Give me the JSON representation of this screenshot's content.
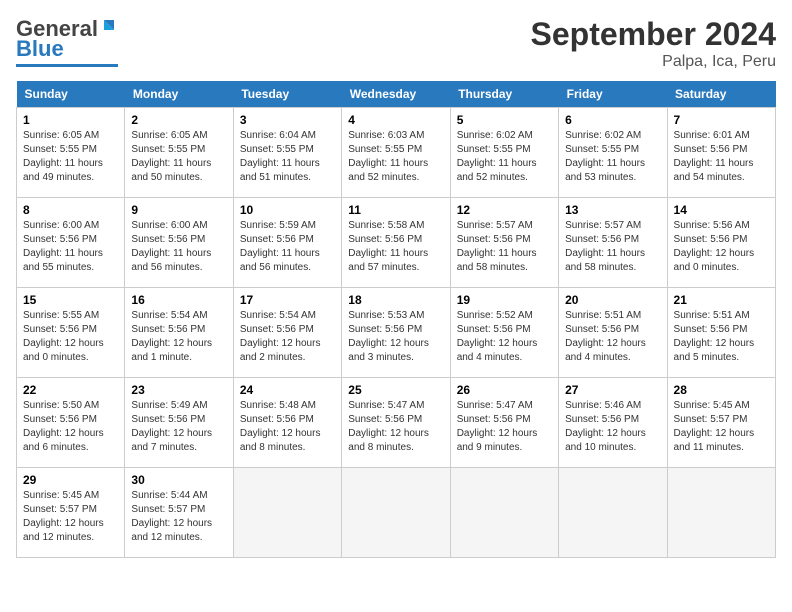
{
  "header": {
    "logo_general": "General",
    "logo_blue": "Blue",
    "month_title": "September 2024",
    "location": "Palpa, Ica, Peru"
  },
  "days_of_week": [
    "Sunday",
    "Monday",
    "Tuesday",
    "Wednesday",
    "Thursday",
    "Friday",
    "Saturday"
  ],
  "weeks": [
    [
      {
        "num": "1",
        "sunrise": "Sunrise: 6:05 AM",
        "sunset": "Sunset: 5:55 PM",
        "daylight": "Daylight: 11 hours and 49 minutes."
      },
      {
        "num": "2",
        "sunrise": "Sunrise: 6:05 AM",
        "sunset": "Sunset: 5:55 PM",
        "daylight": "Daylight: 11 hours and 50 minutes."
      },
      {
        "num": "3",
        "sunrise": "Sunrise: 6:04 AM",
        "sunset": "Sunset: 5:55 PM",
        "daylight": "Daylight: 11 hours and 51 minutes."
      },
      {
        "num": "4",
        "sunrise": "Sunrise: 6:03 AM",
        "sunset": "Sunset: 5:55 PM",
        "daylight": "Daylight: 11 hours and 52 minutes."
      },
      {
        "num": "5",
        "sunrise": "Sunrise: 6:02 AM",
        "sunset": "Sunset: 5:55 PM",
        "daylight": "Daylight: 11 hours and 52 minutes."
      },
      {
        "num": "6",
        "sunrise": "Sunrise: 6:02 AM",
        "sunset": "Sunset: 5:55 PM",
        "daylight": "Daylight: 11 hours and 53 minutes."
      },
      {
        "num": "7",
        "sunrise": "Sunrise: 6:01 AM",
        "sunset": "Sunset: 5:56 PM",
        "daylight": "Daylight: 11 hours and 54 minutes."
      }
    ],
    [
      {
        "num": "8",
        "sunrise": "Sunrise: 6:00 AM",
        "sunset": "Sunset: 5:56 PM",
        "daylight": "Daylight: 11 hours and 55 minutes."
      },
      {
        "num": "9",
        "sunrise": "Sunrise: 6:00 AM",
        "sunset": "Sunset: 5:56 PM",
        "daylight": "Daylight: 11 hours and 56 minutes."
      },
      {
        "num": "10",
        "sunrise": "Sunrise: 5:59 AM",
        "sunset": "Sunset: 5:56 PM",
        "daylight": "Daylight: 11 hours and 56 minutes."
      },
      {
        "num": "11",
        "sunrise": "Sunrise: 5:58 AM",
        "sunset": "Sunset: 5:56 PM",
        "daylight": "Daylight: 11 hours and 57 minutes."
      },
      {
        "num": "12",
        "sunrise": "Sunrise: 5:57 AM",
        "sunset": "Sunset: 5:56 PM",
        "daylight": "Daylight: 11 hours and 58 minutes."
      },
      {
        "num": "13",
        "sunrise": "Sunrise: 5:57 AM",
        "sunset": "Sunset: 5:56 PM",
        "daylight": "Daylight: 11 hours and 58 minutes."
      },
      {
        "num": "14",
        "sunrise": "Sunrise: 5:56 AM",
        "sunset": "Sunset: 5:56 PM",
        "daylight": "Daylight: 12 hours and 0 minutes."
      }
    ],
    [
      {
        "num": "15",
        "sunrise": "Sunrise: 5:55 AM",
        "sunset": "Sunset: 5:56 PM",
        "daylight": "Daylight: 12 hours and 0 minutes."
      },
      {
        "num": "16",
        "sunrise": "Sunrise: 5:54 AM",
        "sunset": "Sunset: 5:56 PM",
        "daylight": "Daylight: 12 hours and 1 minute."
      },
      {
        "num": "17",
        "sunrise": "Sunrise: 5:54 AM",
        "sunset": "Sunset: 5:56 PM",
        "daylight": "Daylight: 12 hours and 2 minutes."
      },
      {
        "num": "18",
        "sunrise": "Sunrise: 5:53 AM",
        "sunset": "Sunset: 5:56 PM",
        "daylight": "Daylight: 12 hours and 3 minutes."
      },
      {
        "num": "19",
        "sunrise": "Sunrise: 5:52 AM",
        "sunset": "Sunset: 5:56 PM",
        "daylight": "Daylight: 12 hours and 4 minutes."
      },
      {
        "num": "20",
        "sunrise": "Sunrise: 5:51 AM",
        "sunset": "Sunset: 5:56 PM",
        "daylight": "Daylight: 12 hours and 4 minutes."
      },
      {
        "num": "21",
        "sunrise": "Sunrise: 5:51 AM",
        "sunset": "Sunset: 5:56 PM",
        "daylight": "Daylight: 12 hours and 5 minutes."
      }
    ],
    [
      {
        "num": "22",
        "sunrise": "Sunrise: 5:50 AM",
        "sunset": "Sunset: 5:56 PM",
        "daylight": "Daylight: 12 hours and 6 minutes."
      },
      {
        "num": "23",
        "sunrise": "Sunrise: 5:49 AM",
        "sunset": "Sunset: 5:56 PM",
        "daylight": "Daylight: 12 hours and 7 minutes."
      },
      {
        "num": "24",
        "sunrise": "Sunrise: 5:48 AM",
        "sunset": "Sunset: 5:56 PM",
        "daylight": "Daylight: 12 hours and 8 minutes."
      },
      {
        "num": "25",
        "sunrise": "Sunrise: 5:47 AM",
        "sunset": "Sunset: 5:56 PM",
        "daylight": "Daylight: 12 hours and 8 minutes."
      },
      {
        "num": "26",
        "sunrise": "Sunrise: 5:47 AM",
        "sunset": "Sunset: 5:56 PM",
        "daylight": "Daylight: 12 hours and 9 minutes."
      },
      {
        "num": "27",
        "sunrise": "Sunrise: 5:46 AM",
        "sunset": "Sunset: 5:56 PM",
        "daylight": "Daylight: 12 hours and 10 minutes."
      },
      {
        "num": "28",
        "sunrise": "Sunrise: 5:45 AM",
        "sunset": "Sunset: 5:57 PM",
        "daylight": "Daylight: 12 hours and 11 minutes."
      }
    ],
    [
      {
        "num": "29",
        "sunrise": "Sunrise: 5:45 AM",
        "sunset": "Sunset: 5:57 PM",
        "daylight": "Daylight: 12 hours and 12 minutes."
      },
      {
        "num": "30",
        "sunrise": "Sunrise: 5:44 AM",
        "sunset": "Sunset: 5:57 PM",
        "daylight": "Daylight: 12 hours and 12 minutes."
      },
      null,
      null,
      null,
      null,
      null
    ]
  ]
}
